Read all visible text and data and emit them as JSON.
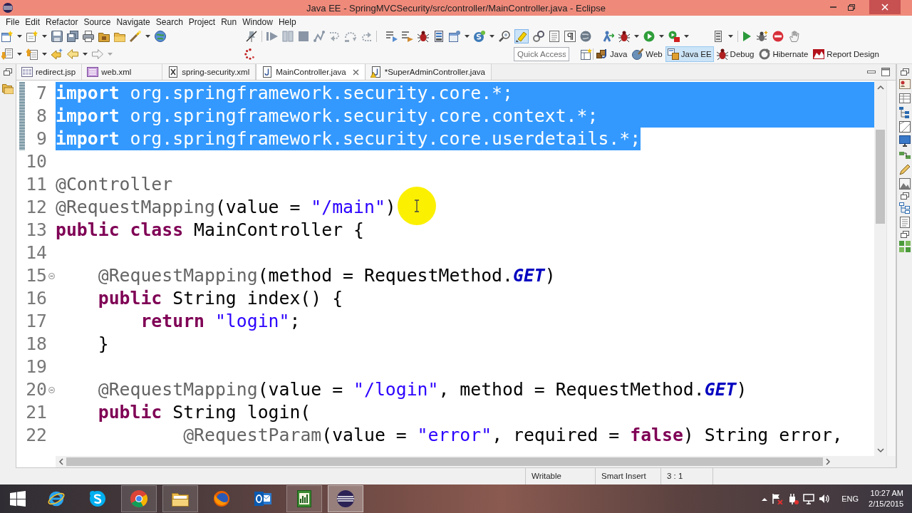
{
  "window": {
    "title": "Java EE - SpringMVCSecurity/src/controller/MainController.java - Eclipse"
  },
  "menu": [
    "File",
    "Edit",
    "Refactor",
    "Source",
    "Navigate",
    "Search",
    "Project",
    "Run",
    "Window",
    "Help"
  ],
  "toolbar": {
    "highlight_toggle": {
      "selected": true
    }
  },
  "quick_access": {
    "placeholder": "Quick Access"
  },
  "perspectives": [
    {
      "label": "Java",
      "kind": "java",
      "selected": false
    },
    {
      "label": "Web",
      "kind": "web",
      "selected": false
    },
    {
      "label": "Java EE",
      "kind": "javaee",
      "selected": true
    },
    {
      "label": "Debug",
      "kind": "debug",
      "selected": false
    },
    {
      "label": "Hibernate",
      "kind": "hibernate",
      "selected": false
    },
    {
      "label": "Report Design",
      "kind": "report",
      "selected": false
    }
  ],
  "editor_tabs": [
    {
      "label": "redirect.jsp",
      "kind": "jsp",
      "selected": false,
      "warning": false
    },
    {
      "label": "web.xml",
      "kind": "webxml",
      "selected": false,
      "warning": false
    },
    {
      "label": "spring-security.xml",
      "kind": "xml",
      "selected": false,
      "warning": false
    },
    {
      "label": "MainController.java",
      "kind": "java",
      "selected": true,
      "warning": false
    },
    {
      "label": "*SuperAdminController.java",
      "kind": "java",
      "selected": false,
      "warning": true
    }
  ],
  "editor": {
    "lines": [
      {
        "number": "7",
        "selected": true,
        "selected_newline": true,
        "range_marked": true,
        "fold_marker": false,
        "tokens": [
          {
            "kind": "keyword",
            "text": "import"
          },
          {
            "kind": "plain",
            "text": " org.springframework.security.core.*;"
          }
        ]
      },
      {
        "number": "8",
        "selected": true,
        "selected_newline": true,
        "range_marked": true,
        "fold_marker": false,
        "tokens": [
          {
            "kind": "keyword",
            "text": "import"
          },
          {
            "kind": "plain",
            "text": " org.springframework.security.core.context.*;"
          }
        ]
      },
      {
        "number": "9",
        "selected": true,
        "selected_newline": false,
        "range_marked": true,
        "fold_marker": false,
        "tokens": [
          {
            "kind": "keyword",
            "text": "import"
          },
          {
            "kind": "plain",
            "text": " org.springframework.security.core.userdetails.*;"
          }
        ]
      },
      {
        "number": "10",
        "selected": false,
        "selected_newline": false,
        "range_marked": false,
        "fold_marker": false
      },
      {
        "number": "11",
        "selected": false,
        "selected_newline": false,
        "range_marked": false,
        "fold_marker": false,
        "tokens": [
          {
            "kind": "annotation",
            "text": "@Controller"
          }
        ]
      },
      {
        "number": "12",
        "selected": false,
        "selected_newline": false,
        "range_marked": false,
        "fold_marker": false,
        "tokens": [
          {
            "kind": "annotation",
            "text": "@RequestMapping"
          },
          {
            "kind": "plain",
            "text": "(value = "
          },
          {
            "kind": "string",
            "text": "\"/main\""
          },
          {
            "kind": "plain",
            "text": ")"
          }
        ]
      },
      {
        "number": "13",
        "selected": false,
        "selected_newline": false,
        "range_marked": false,
        "fold_marker": false,
        "tokens": [
          {
            "kind": "keyword",
            "text": "public"
          },
          {
            "kind": "keyword",
            "text": " class"
          },
          {
            "kind": "plain",
            "text": " MainController {"
          }
        ]
      },
      {
        "number": "14",
        "selected": false,
        "selected_newline": false,
        "range_marked": false,
        "fold_marker": false
      },
      {
        "number": "15",
        "selected": false,
        "selected_newline": false,
        "range_marked": false,
        "fold_marker": true,
        "tokens": [
          {
            "kind": "annotation",
            "text": "    @RequestMapping"
          },
          {
            "kind": "plain",
            "text": "(method = RequestMethod."
          },
          {
            "kind": "constant",
            "text": "GET"
          },
          {
            "kind": "plain",
            "text": ")"
          }
        ]
      },
      {
        "number": "16",
        "selected": false,
        "selected_newline": false,
        "range_marked": false,
        "fold_marker": false,
        "tokens": [
          {
            "kind": "keyword",
            "text": "    public"
          },
          {
            "kind": "plain",
            "text": " String index() {"
          }
        ]
      },
      {
        "number": "17",
        "selected": false,
        "selected_newline": false,
        "range_marked": false,
        "fold_marker": false,
        "tokens": [
          {
            "kind": "keyword",
            "text": "        return"
          },
          {
            "kind": "string",
            "text": " \"login\""
          },
          {
            "kind": "plain",
            "text": ";"
          }
        ]
      },
      {
        "number": "18",
        "selected": false,
        "selected_newline": false,
        "range_marked": false,
        "fold_marker": false,
        "tokens": [
          {
            "kind": "plain",
            "text": "    }"
          }
        ]
      },
      {
        "number": "19",
        "selected": false,
        "selected_newline": false,
        "range_marked": false,
        "fold_marker": false
      },
      {
        "number": "20",
        "selected": false,
        "selected_newline": false,
        "range_marked": false,
        "fold_marker": true,
        "tokens": [
          {
            "kind": "annotation",
            "text": "    @RequestMapping"
          },
          {
            "kind": "plain",
            "text": "(value = "
          },
          {
            "kind": "string",
            "text": "\"/login\""
          },
          {
            "kind": "plain",
            "text": ", method = RequestMethod."
          },
          {
            "kind": "constant",
            "text": "GET"
          },
          {
            "kind": "plain",
            "text": ")"
          }
        ]
      },
      {
        "number": "21",
        "selected": false,
        "selected_newline": false,
        "range_marked": false,
        "fold_marker": false,
        "tokens": [
          {
            "kind": "keyword",
            "text": "    public"
          },
          {
            "kind": "plain",
            "text": " String login("
          }
        ]
      },
      {
        "number": "22",
        "selected": false,
        "selected_newline": false,
        "range_marked": false,
        "fold_marker": false,
        "tokens": [
          {
            "kind": "annotation",
            "text": "            @RequestParam"
          },
          {
            "kind": "plain",
            "text": "(value = "
          },
          {
            "kind": "string",
            "text": "\"error\""
          },
          {
            "kind": "plain",
            "text": ", required = "
          },
          {
            "kind": "keyword",
            "text": "false"
          },
          {
            "kind": "plain",
            "text": ") String error,"
          }
        ]
      }
    ]
  },
  "status_bar": {
    "fields": [
      "Writable",
      "Smart Insert",
      "3 : 1"
    ]
  },
  "taskbar": {
    "apps": [
      {
        "kind": "ebrowser",
        "running": false,
        "selected": false
      },
      {
        "kind": "bubble",
        "running": false,
        "selected": false
      },
      {
        "kind": "segments",
        "running": true,
        "selected": false
      },
      {
        "kind": "folder",
        "running": true,
        "selected": false
      },
      {
        "kind": "flameglobe",
        "running": false,
        "selected": false
      },
      {
        "kind": "mail",
        "running": false,
        "selected": false
      },
      {
        "kind": "chartdoc",
        "running": true,
        "selected": false
      },
      {
        "kind": "striped",
        "running": true,
        "selected": true
      }
    ],
    "tray": {
      "language": "ENG",
      "time": "10:27 AM",
      "date": "2/15/2015"
    }
  }
}
